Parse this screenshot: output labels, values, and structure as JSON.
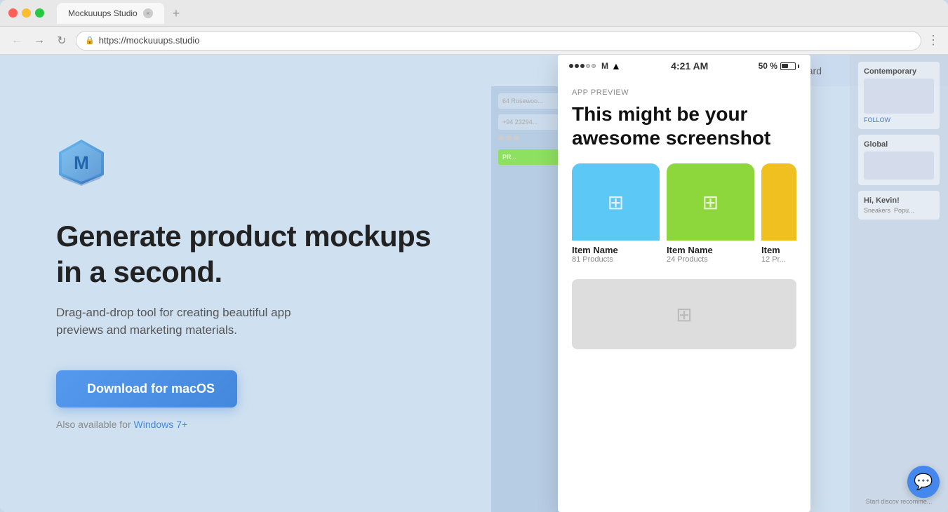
{
  "browser": {
    "tab_title": "Mockuuups Studio",
    "url": "https://mockuuups.studio",
    "menu_dots": "⋮"
  },
  "hero": {
    "title": "Generate product mockups in a second.",
    "subtitle": "Drag-and-drop tool for creating beautiful app previews and marketing materials.",
    "download_label": "Download for macOS",
    "also_available_prefix": "Also available for",
    "windows_link_label": "Windows 7+"
  },
  "phone": {
    "status_bar": {
      "time": "4:21 AM",
      "carrier": "M",
      "battery_pct": "50 %"
    },
    "app_preview_label": "APP PREVIEW",
    "app_preview_title": "This might be your awesome screenshot",
    "items": [
      {
        "name": "Item Name",
        "count": "81 Products",
        "color": "blue"
      },
      {
        "name": "Item Name",
        "count": "24 Products",
        "color": "green"
      },
      {
        "name": "Item",
        "count": "12 Pr...",
        "color": "yellow"
      }
    ]
  },
  "bg_right": {
    "label1": "Contemporary",
    "label2": "Global",
    "label3": "Hi, Kevin!",
    "cta": "Start discov recomme..."
  },
  "leaderboard": {
    "label": "Leaderboard"
  },
  "chat": {
    "icon": "💬"
  }
}
